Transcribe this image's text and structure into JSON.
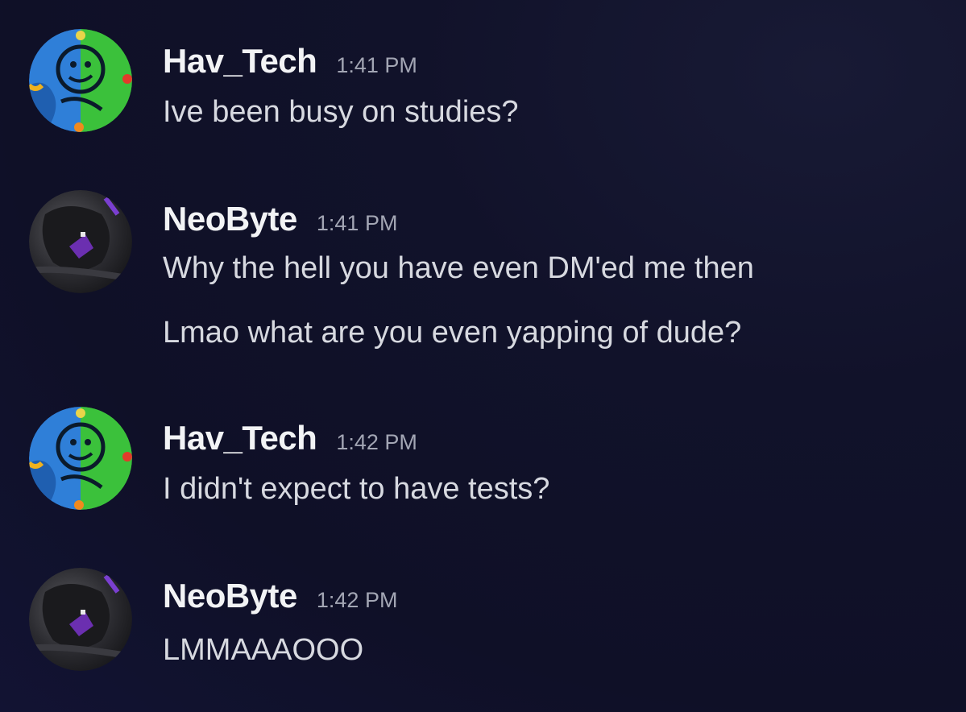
{
  "messages": [
    {
      "author": "Hav_Tech",
      "avatar": "hav-tech-avatar-icon",
      "time": "1:41 PM",
      "lines": [
        "Ive been busy on studies?"
      ]
    },
    {
      "author": "NeoByte",
      "avatar": "neobyte-avatar-icon",
      "time": "1:41 PM",
      "lines": [
        "Why the hell you have even DM'ed me then",
        "Lmao what are you even yapping of dude?"
      ]
    },
    {
      "author": "Hav_Tech",
      "avatar": "hav-tech-avatar-icon",
      "time": "1:42 PM",
      "lines": [
        "I didn't expect to have tests?"
      ]
    },
    {
      "author": "NeoByte",
      "avatar": "neobyte-avatar-icon",
      "time": "1:42 PM",
      "lines": [
        "LMMAAAOOO"
      ]
    }
  ],
  "colors": {
    "background": "#11122a",
    "username": "#f2f3f5",
    "timestamp": "#a3a6b4",
    "message_text": "#d7d9e0"
  }
}
